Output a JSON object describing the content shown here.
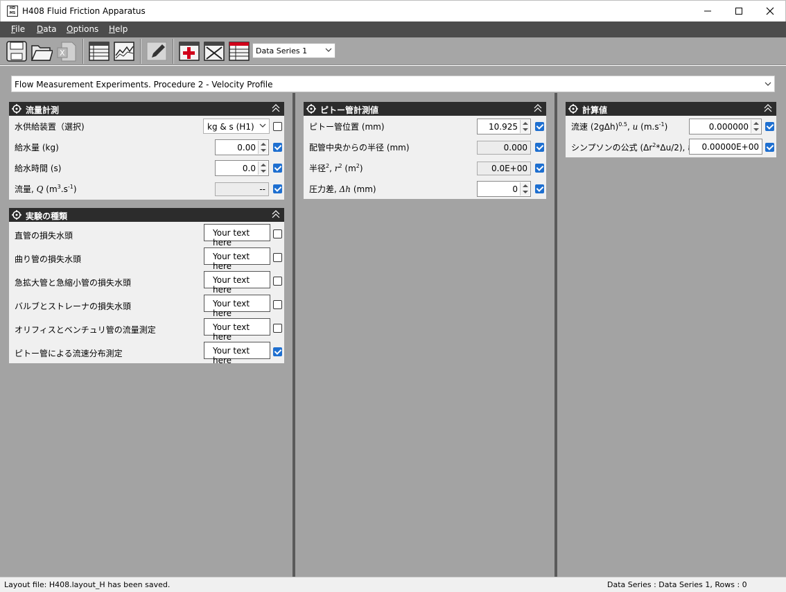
{
  "window": {
    "icon_text": "HD MS",
    "title": "H408 Fluid Friction Apparatus"
  },
  "menu": {
    "file": "File",
    "data": "Data",
    "options": "Options",
    "help": "Help"
  },
  "toolbar": {
    "icons": [
      "save-icon",
      "open-folder-icon",
      "excel-export-icon",
      "table-view-icon",
      "graph-view-icon",
      "pencil-icon",
      "add-row-icon",
      "delete-row-icon",
      "data-series-table-icon"
    ],
    "data_series_selected": "Data Series 1"
  },
  "procedure": {
    "selected": "Flow Measurement Experiments. Procedure 2 - Velocity Profile"
  },
  "flow_panel": {
    "title": "流量計測",
    "rows": [
      {
        "label": "水供給装置（選択)",
        "value": "kg & s (H1)",
        "checked": false
      },
      {
        "label": "給水量 (kg)",
        "value": "0.00",
        "checked": true
      },
      {
        "label": "給水時間 (s)",
        "value": "0.0",
        "checked": true
      },
      {
        "label_pre": "流量, ",
        "label_var": "Q",
        "label_mid": " (m",
        "label_sup1": "3",
        "label_mid2": ".s",
        "label_sup2": "-1",
        "label_post": ")",
        "value": "--",
        "checked": true
      }
    ]
  },
  "experiment_panel": {
    "title": "実験の種類",
    "rows": [
      {
        "label": "直管の損失水頭",
        "text": "Your text here",
        "checked": false
      },
      {
        "label": "曲り管の損失水頭",
        "text": "Your text here",
        "checked": false
      },
      {
        "label": "急拡大管と急縮小管の損失水頭",
        "text": "Your text here",
        "checked": false
      },
      {
        "label": "バルブとストレーナの損失水頭",
        "text": "Your text here",
        "checked": false
      },
      {
        "label": "オリフィスとベンチュリ管の流量測定",
        "text": "Your text here",
        "checked": false
      },
      {
        "label": "ピトー管による流速分布測定",
        "text": "Your text here",
        "checked": true
      }
    ]
  },
  "pitot_panel": {
    "title": "ピトー管計測値",
    "rows": [
      {
        "label": "ピトー管位置 (mm)",
        "value": "10.925",
        "checked": true
      },
      {
        "label": "配管中央からの半径 (mm)",
        "value": "0.000",
        "checked": true
      },
      {
        "label_pre": "半径",
        "label_sup1": "2",
        "label_mid": ", ",
        "label_var": "r",
        "label_sup2": "2",
        "label_mid2": " (m",
        "label_sup3": "2",
        "label_post": ")",
        "value": "0.0E+00",
        "checked": true
      },
      {
        "label_pre": "圧力差, ",
        "label_var": "Δh",
        "label_post": " (mm)",
        "value": "0",
        "checked": true
      }
    ]
  },
  "calc_panel": {
    "title": "計算値",
    "rows": [
      {
        "label_pre": "流速 (2gΔh)",
        "label_sup": "0.5",
        "label_mid": ", ",
        "label_var": "u",
        "label_mid2": " (m.s",
        "label_sup2": "-1",
        "label_post": ")",
        "value": "0.000000",
        "checked": true
      },
      {
        "label_pre": "シンプソンの公式 (Δr",
        "label_sup": "2",
        "label_mid": "*Δu/2), ",
        "label_var": "u",
        "value": "0.00000E+00",
        "checked": true
      }
    ]
  },
  "status": {
    "left": "Layout file: H408.layout_H has been saved.",
    "right": "Data Series : Data Series 1,  Rows : 0"
  },
  "colors": {
    "menubar": "#4c4c4c",
    "toolbar": "#a6a6a6",
    "workspace": "#a3a3a3",
    "panel_header": "#2c2c2c",
    "checkbox_on": "#1e6fd0"
  }
}
